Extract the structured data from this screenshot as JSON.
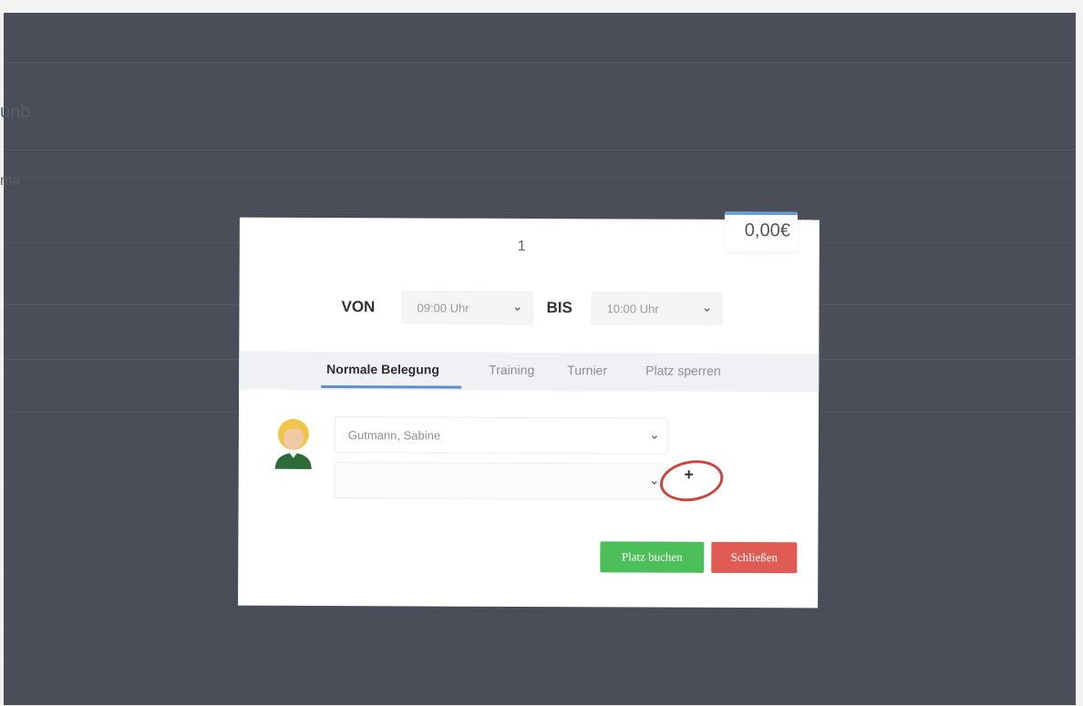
{
  "background": {
    "fragments": [
      "unb",
      "ma"
    ]
  },
  "modal": {
    "price": "0,00€",
    "court_number": "1",
    "von_label": "VON",
    "von_value": "09:00 Uhr",
    "bis_label": "BIS",
    "bis_value": "10:00 Uhr",
    "tabs": [
      {
        "label": "Normale Belegung",
        "active": true
      },
      {
        "label": "Training",
        "active": false
      },
      {
        "label": "Turnier",
        "active": false
      },
      {
        "label": "Platz sperren",
        "active": false
      }
    ],
    "player1_value": "Gutmann, Sabine",
    "player2_value": "",
    "add_player_symbol": "+",
    "book_button": "Platz buchen",
    "close_button": "Schließen"
  },
  "colors": {
    "overlay": "#4a4d57",
    "book": "#4cbf5a",
    "close": "#e15b55",
    "tab_underline": "#5f8ec9",
    "annotation": "#c9463f"
  },
  "icons": [
    "chevron-down-icon",
    "plus-icon",
    "avatar-icon"
  ]
}
